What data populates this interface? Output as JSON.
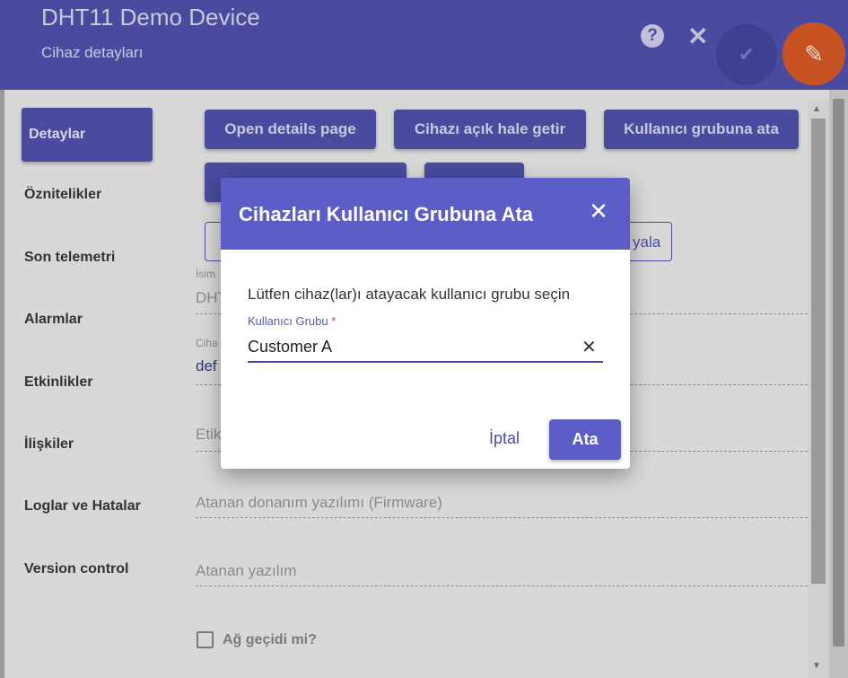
{
  "header": {
    "title": "DHT11 Demo Device",
    "subtitle": "Cihaz detayları",
    "help_icon": "help-icon",
    "close_icon": "close-icon",
    "check_icon": "check-icon",
    "edit_icon": "edit-pencil-icon"
  },
  "sidebar": {
    "items": [
      {
        "label": "Detaylar"
      },
      {
        "label": "Öznitelikler"
      },
      {
        "label": "Son telemetri"
      },
      {
        "label": "Alarmlar"
      },
      {
        "label": "Etkinlikler"
      },
      {
        "label": "İlişkiler"
      },
      {
        "label": "Loglar ve Hatalar"
      },
      {
        "label": "Version control"
      }
    ]
  },
  "actions": {
    "open_details": "Open details page",
    "make_public": "Cihazı açık hale getir",
    "assign_group": "Kullanıcı grubuna ata",
    "partial_copy": "yala"
  },
  "fields": {
    "name_label_partial": "İsim",
    "name_value_partial": "DHT",
    "profile_label_partial": "Ciha",
    "profile_value_partial": "def",
    "label_partial": "Etik",
    "firmware_label": "Atanan donanım yazılımı (Firmware)",
    "software_label": "Atanan yazılım",
    "gateway_label": "Ağ geçidi mi?"
  },
  "dialog": {
    "title": "Cihazları Kullanıcı Grubuna Ata",
    "prompt": "Lütfen cihaz(lar)ı atayacak kullanıcı grubu seçin",
    "field_label": "Kullanıcı Grubu",
    "required_mark": "*",
    "field_value": "Customer A",
    "clear_icon": "clear-icon",
    "cancel_label": "İptal",
    "ok_label": "Ata"
  },
  "colors": {
    "primary": "#5c5dc7",
    "header_dim": "#4a4b9e",
    "fab_accent": "#c75222"
  }
}
